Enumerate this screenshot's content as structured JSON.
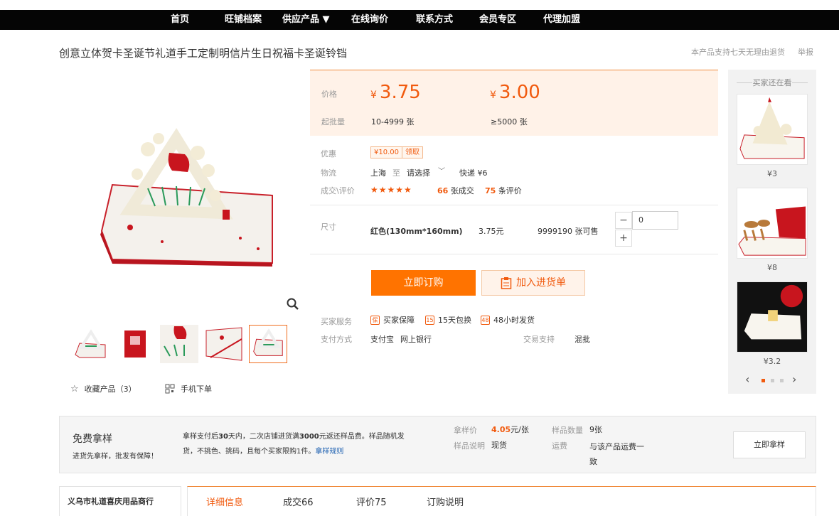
{
  "nav": [
    "首页",
    "旺铺档案",
    "供应产品 ▼",
    "在线询价",
    "联系方式",
    "会员专区",
    "代理加盟"
  ],
  "product": {
    "title": "创意立体贺卡圣诞节礼道手工定制明信片生日祝福卡圣诞铃铛",
    "policy": "本产品支持七天无理由退货",
    "report": "举报"
  },
  "gallery": {
    "favorite": "收藏产品（3）",
    "mobile": "手机下单"
  },
  "price": {
    "label": "价格",
    "currency": "¥",
    "p1": "3.75",
    "p2": "3.00",
    "moq_label": "起批量",
    "moq1": "10-4999 张",
    "moq2": "≥5000 张"
  },
  "info": {
    "promo_label": "优惠",
    "coupon_value": "¥10.00",
    "coupon_action": "领取",
    "logistics_label": "物流",
    "origin": "上海",
    "to": "至",
    "dest": "请选择",
    "express": "快递 ¥6",
    "deals_label": "成交\\评价",
    "stars": "★★★★★",
    "deals_count": "66",
    "deals_unit": "张成交",
    "reviews_count": "75",
    "reviews_unit": "条评价",
    "rating": 4.5
  },
  "sku": {
    "label": "尺寸",
    "name": "红色(130mm*160mm)",
    "price": "3.75元",
    "stock": "9999190 张可售",
    "qty": "0",
    "minus": "−",
    "plus": "+"
  },
  "actions": {
    "buy": "立即订购",
    "cart": "加入进货单"
  },
  "services": {
    "label": "买家服务",
    "items": [
      "买家保障",
      "15天包换",
      "48小时发货"
    ],
    "pay_label": "支付方式",
    "pay1": "支付宝",
    "pay2": "网上银行",
    "trade_label": "交易支持",
    "trade": "混批"
  },
  "rail": {
    "title": "买家还在看",
    "prices": [
      "¥3",
      "¥8",
      "¥3.2"
    ]
  },
  "sample": {
    "title": "免费拿样",
    "subtitle": "进货先拿样，批发有保障！",
    "desc_a": "拿样支付后",
    "desc_days": "30",
    "desc_b": "天内，二次店铺进货满",
    "desc_amt": "3000",
    "desc_c": "元返还样品费。样品随机发货，不挑色、挑码，且每个买家限购1件。",
    "rules": "拿样规则",
    "price_label": "拿样价",
    "price_value": "4.05",
    "price_unit": "元/张",
    "qty_label": "样品数量",
    "qty_value": "9张",
    "note_label": "样品说明",
    "note_value": "现货",
    "ship_label": "运费",
    "ship_value": "与该产品运费一致",
    "button": "立即拿样"
  },
  "shop": {
    "name": "义乌市礼道喜庆用品商行"
  },
  "tabs": [
    "详细信息",
    "成交66",
    "评价75",
    "订购说明"
  ],
  "colors": {
    "accent": "#f15a0e",
    "buy": "#ff7300",
    "nav": "#050505"
  }
}
